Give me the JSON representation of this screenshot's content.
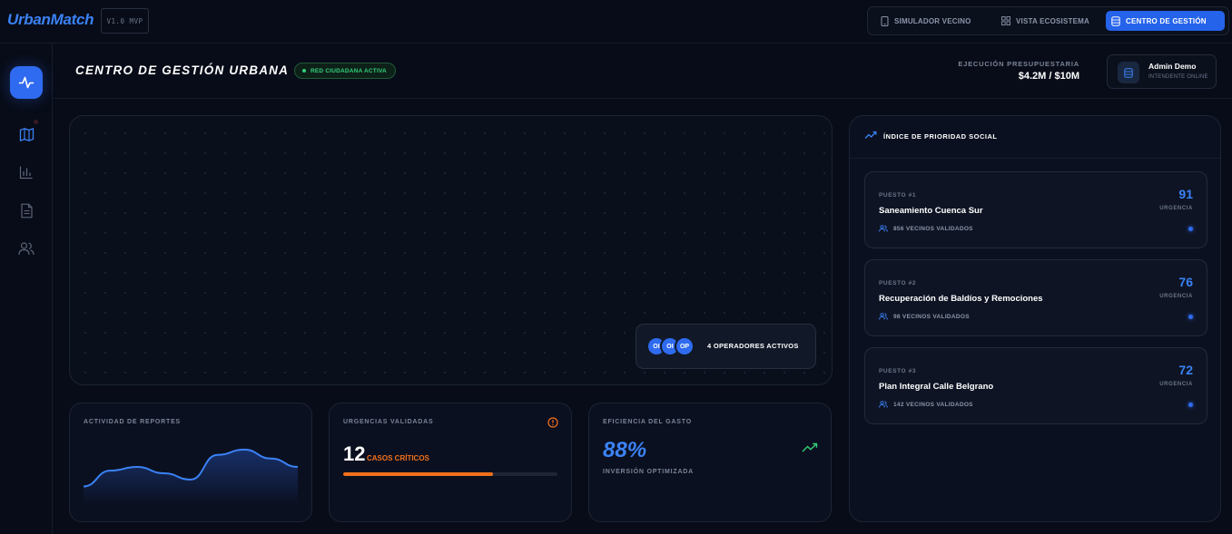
{
  "app": {
    "name": "UrbanMatch",
    "version": "V1.0 MVP"
  },
  "modes": [
    {
      "label": "SIMULADOR VECINO",
      "icon": "phone-icon",
      "active": false
    },
    {
      "label": "VISTA ECOSISTEMA",
      "icon": "grid-icon",
      "active": false
    },
    {
      "label": "CENTRO DE GESTIÓN",
      "icon": "database-icon",
      "active": true
    }
  ],
  "sidebar": {
    "items": [
      {
        "name": "activity",
        "icon": "activity-icon",
        "active": true
      },
      {
        "name": "map",
        "icon": "map-icon",
        "active": false,
        "notification": true
      },
      {
        "name": "stats",
        "icon": "bar-chart-icon",
        "active": false
      },
      {
        "name": "reports",
        "icon": "document-icon",
        "active": false
      },
      {
        "name": "users",
        "icon": "users-icon",
        "active": false
      }
    ]
  },
  "header": {
    "title": "CENTRO DE GESTIÓN URBANA",
    "status": "RED CIUDADANA ACTIVA",
    "budget_label": "EJECUCIÓN PRESUPUESTARIA",
    "budget_value": "$4.2M / $10M"
  },
  "user": {
    "name": "Admin Demo",
    "role": "INTENDENTE ONLINE"
  },
  "map": {
    "operators": [
      "OI",
      "OI",
      "OP"
    ],
    "operators_label": "4 OPERADORES ACTIVOS"
  },
  "kpis": {
    "activity": {
      "title": "ACTIVIDAD DE REPORTES",
      "trend": [
        0.25,
        0.55,
        0.62,
        0.5,
        0.38,
        0.85,
        0.95,
        0.78,
        0.62
      ]
    },
    "urgencies": {
      "title": "URGENCIAS VALIDADAS",
      "value": "12",
      "label": "CASOS CRÍTICOS",
      "progress": 0.7
    },
    "efficiency": {
      "title": "EFICIENCIA DEL GASTO",
      "value": "88%",
      "subtitle": "INVERSIÓN OPTIMIZADA"
    }
  },
  "priority": {
    "title": "ÍNDICE DE PRIORIDAD SOCIAL",
    "score_label": "URGENCIA",
    "items": [
      {
        "position": "PUESTO #1",
        "name": "Saneamiento Cuenca Sur",
        "votes": "856 VECINOS VALIDADOS",
        "score": "91"
      },
      {
        "position": "PUESTO #2",
        "name": "Recuperación de Baldíos y Remociones",
        "votes": "98 VECINOS VALIDADOS",
        "score": "76"
      },
      {
        "position": "PUESTO #3",
        "name": "Plan Integral Calle Belgrano",
        "votes": "142 VECINOS VALIDADOS",
        "score": "72"
      }
    ]
  },
  "colors": {
    "accent": "#2f6bf0",
    "background": "#080c18",
    "success": "#34d07a",
    "warning": "#f2711c"
  }
}
